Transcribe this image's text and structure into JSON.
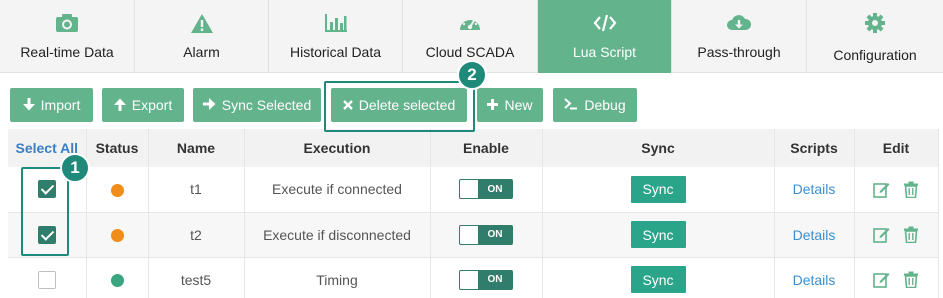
{
  "tabs": [
    {
      "label": "Real-time Data",
      "icon": "camera-icon",
      "active": false
    },
    {
      "label": "Alarm",
      "icon": "warning-icon",
      "active": false
    },
    {
      "label": "Historical Data",
      "icon": "bar-chart-icon",
      "active": false
    },
    {
      "label": "Cloud SCADA",
      "icon": "dashboard-icon",
      "active": false
    },
    {
      "label": "Lua Script",
      "icon": "code-icon",
      "active": true
    },
    {
      "label": "Pass-through",
      "icon": "cloud-download-icon",
      "active": false
    },
    {
      "label": "Configuration",
      "icon": "gear-icon",
      "active": false
    }
  ],
  "toolbar": {
    "import_label": "Import",
    "export_label": "Export",
    "sync_selected_label": "Sync Selected",
    "delete_selected_label": "Delete selected",
    "new_label": "New",
    "debug_label": "Debug"
  },
  "table": {
    "headers": {
      "select_all": "Select All",
      "status": "Status",
      "name": "Name",
      "execution": "Execution",
      "enable": "Enable",
      "sync": "Sync",
      "scripts": "Scripts",
      "edit": "Edit"
    },
    "rows": [
      {
        "checked": true,
        "status_color": "#f08c1a",
        "name": "t1",
        "execution": "Execute if connected",
        "enable": "ON",
        "sync": "Sync",
        "scripts": "Details"
      },
      {
        "checked": true,
        "status_color": "#f08c1a",
        "name": "t2",
        "execution": "Execute if disconnected",
        "enable": "ON",
        "sync": "Sync",
        "scripts": "Details"
      },
      {
        "checked": false,
        "status_color": "#3aa57e",
        "name": "test5",
        "execution": "Timing",
        "enable": "ON",
        "sync": "Sync",
        "scripts": "Details"
      }
    ]
  },
  "annotations": {
    "badge_1": "1",
    "badge_2": "2"
  },
  "colors": {
    "accent": "#63b38c",
    "dark_accent": "#2f7d6a",
    "sync_button": "#2aa58a",
    "link": "#3a8fd1",
    "annotation": "#1f8a7a"
  }
}
